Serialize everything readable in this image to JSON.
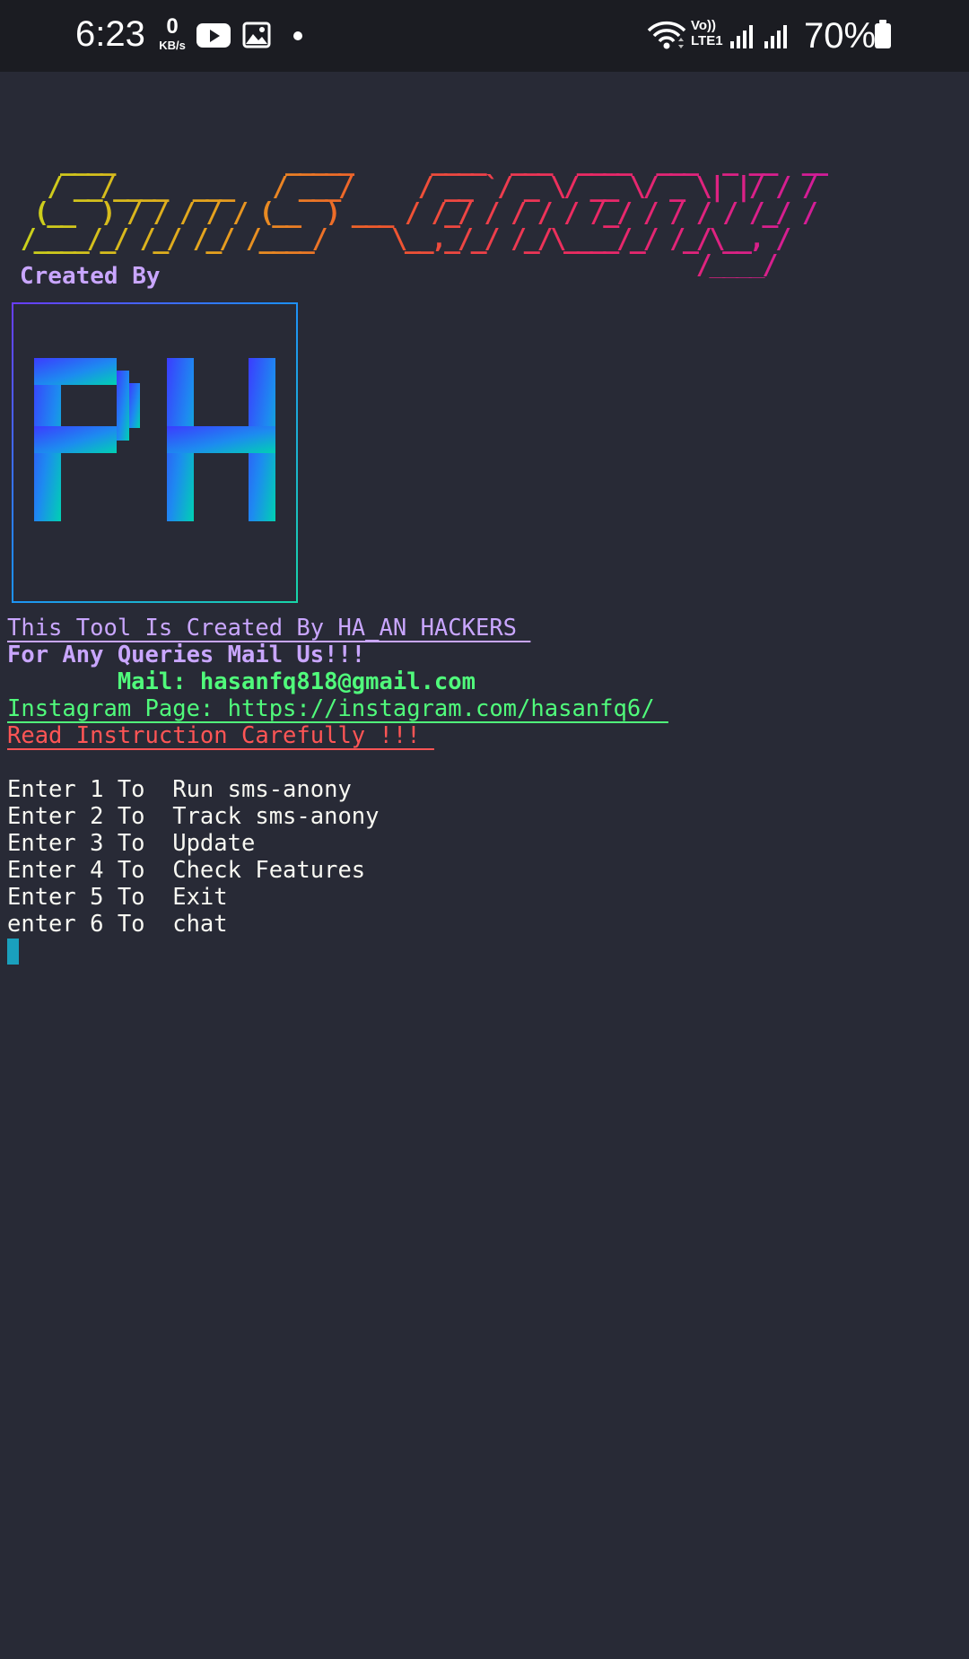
{
  "status_bar": {
    "time": "6:23",
    "net_speed_value": "0",
    "net_speed_unit": "KB/s",
    "network_label_top": "Vo))",
    "network_label_bottom": "LTE1",
    "battery_percent": "70%",
    "icons": [
      "youtube-icon",
      "gallery-icon",
      "notification-dot-icon",
      "wifi-icon",
      "signal-icon",
      "signal-icon",
      "battery-icon"
    ]
  },
  "terminal": {
    "banner_lines": [
      "    ____             _____      ____  ___  ____  ___  _ __  __",
      "   / __/____  ___   / ___/     / __ `/ _ \\/ __ \\/ _ \\| |/ / / ",
      "  (__  ) / / / / / (__  ) ___ / /_/ / / / / /_/ / / / / /_/ / ",
      " /____/_/ /_/ /_/ /____/     \\__,_/_/ /_/\\____/_/ /_/\\__, / ",
      "                                                    /____/  "
    ],
    "created_by_label": "Created By",
    "logo_text": "PH",
    "credit_line": "This Tool Is Created By HA_AN HACKERS ",
    "queries_line": "For Any Queries Mail Us!!!",
    "mail_line": "        Mail: hasanfq818@gmail.com",
    "instagram_line": "Instagram Page: https://instagram.com/hasanfq6/ ",
    "warning_line": "Read Instruction Carefully !!! ",
    "menu": [
      "Enter 1 To  Run sms-anony",
      "Enter 2 To  Track sms-anony",
      "Enter 3 To  Update",
      "Enter 4 To  Check Features",
      "Enter 5 To  Exit",
      "enter 6 To  chat"
    ]
  },
  "colors": {
    "terminal_background": "#282a36",
    "status_bar_background": "#1b1c22",
    "purple_text": "#c9a6ff",
    "green_text": "#50fa7b",
    "red_text": "#ff5555",
    "cursor": "#1aa0bd",
    "logo_gradient_start": "#3b3cff",
    "logo_gradient_end": "#00d1b2"
  }
}
